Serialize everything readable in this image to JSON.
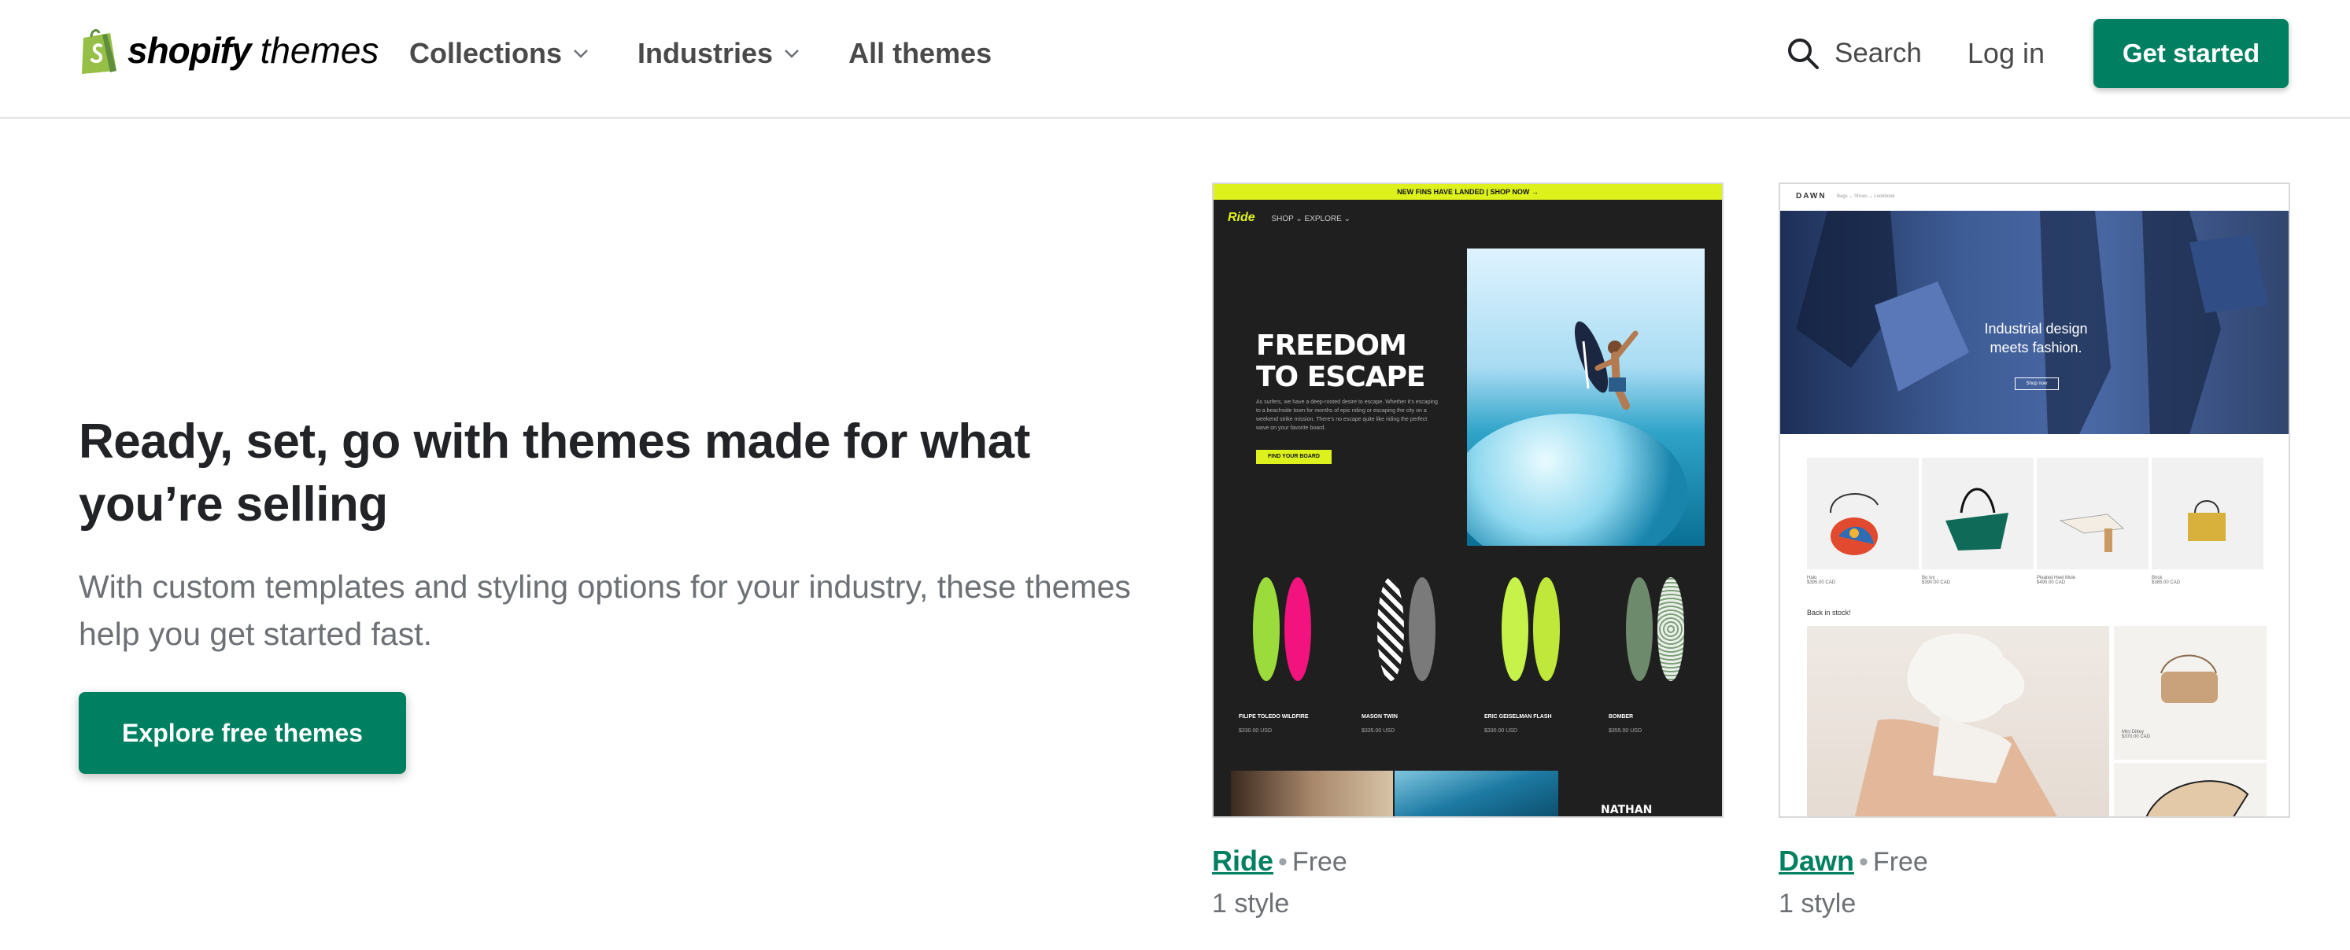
{
  "header": {
    "logo_word": "shopify",
    "logo_suffix": "themes",
    "nav": [
      {
        "label": "Collections",
        "has_dropdown": true
      },
      {
        "label": "Industries",
        "has_dropdown": true
      },
      {
        "label": "All themes",
        "has_dropdown": false
      }
    ],
    "search_label": "Search",
    "login_label": "Log in",
    "cta_label": "Get started"
  },
  "hero": {
    "title": "Ready, set, go with themes made for what you’re selling",
    "subtitle": "With custom templates and styling options for your industry, these themes help you get started fast.",
    "cta_label": "Explore free themes"
  },
  "themes": [
    {
      "name": "Ride",
      "price": "Free",
      "styles": "1 style",
      "preview": {
        "announcement": "NEW FINS HAVE LANDED  |  SHOP NOW →",
        "logo": "Ride",
        "nav_text": "SHOP ⌄    EXPLORE ⌄",
        "headline": "FREEDOM TO ESCAPE",
        "body": "As surfers, we have a deep-rooted desire to escape. Whether it's escaping to a beachside town for months of epic riding or escaping the city on a weekend strike mission. There's no escape quite like riding the perfect wave on your favorite board.",
        "button": "FIND YOUR BOARD",
        "products": [
          {
            "name": "FILIPE TOLEDO WILDFIRE",
            "price": "$330.00 USD"
          },
          {
            "name": "MASON TWIN",
            "price": "$335.00 USD"
          },
          {
            "name": "ERIC GEISELMAN FLASH",
            "price": "$330.00 USD"
          },
          {
            "name": "BOMBER",
            "price": "$355.00 USD"
          }
        ],
        "footer_text": "NATHAN FLORENCE"
      }
    },
    {
      "name": "Dawn",
      "price": "Free",
      "styles": "1 style",
      "preview": {
        "brand": "DAWN",
        "nav_text": "Bags ⌄   Shoes ⌄   Lookbook",
        "headline": "Industrial design meets fashion.",
        "button": "Shop now",
        "products": [
          {
            "name": "Halo",
            "price": "$395.00 CAD"
          },
          {
            "name": "Bo Ivy",
            "price": "$390.00 CAD"
          },
          {
            "name": "Pleated Heel Mule",
            "price": "$495.00 CAD"
          },
          {
            "name": "Brick",
            "price": "$385.00 CAD"
          }
        ],
        "section_title": "Back in stock!",
        "side_product": {
          "name": "Mini Dittey",
          "price": "$370.00 CAD"
        }
      }
    }
  ],
  "colors": {
    "brand_green": "#008060",
    "ride_accent": "#ddf21c",
    "text_dark": "#212326",
    "text_muted": "#6d7175"
  }
}
